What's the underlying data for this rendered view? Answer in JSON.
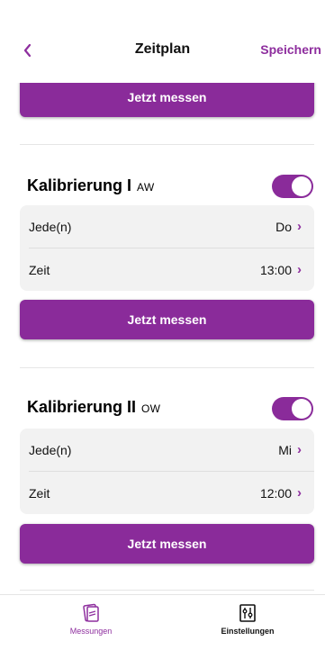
{
  "header": {
    "back_symbol": "<",
    "title": "Zeitplan",
    "save_label": "Speichern"
  },
  "measure_label": "Jetzt messen",
  "sections": [
    {
      "title": "Kalibrierung I",
      "tag": "AW",
      "enabled": true,
      "rows": [
        {
          "label": "Jede(n)",
          "value": "Do"
        },
        {
          "label": "Zeit",
          "value": "13:00"
        }
      ]
    },
    {
      "title": "Kalibrierung II",
      "tag": "OW",
      "enabled": true,
      "rows": [
        {
          "label": "Jede(n)",
          "value": "Mi"
        },
        {
          "label": "Zeit",
          "value": "12:00"
        }
      ]
    }
  ],
  "nav": {
    "measure_label": "Messungen",
    "settings_label": "Einstellungen"
  },
  "colors": {
    "accent": "#8a2b9a",
    "card_bg": "#f2f2f2"
  },
  "icons": {
    "back": "chevron-left-icon",
    "row_chevron": "chevron-right-icon",
    "measure_nav": "measurements-icon",
    "settings_nav": "settings-sliders-icon"
  }
}
